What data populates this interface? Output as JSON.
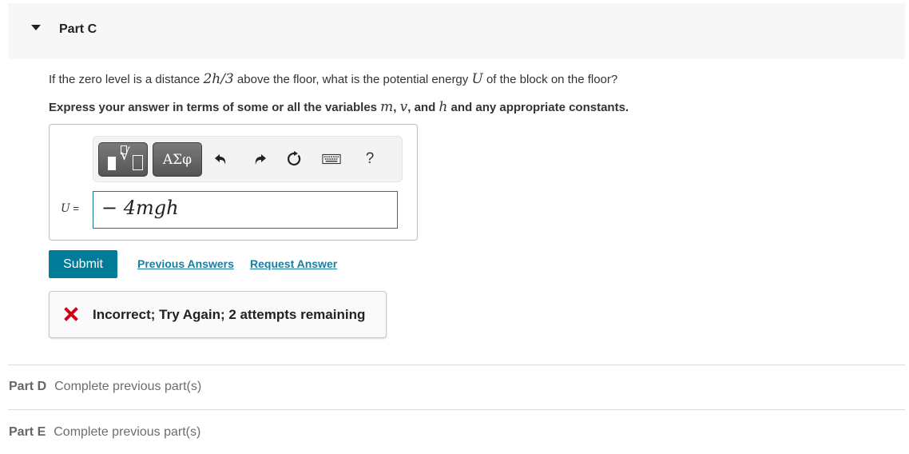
{
  "part_c": {
    "title": "Part C",
    "expanded": true,
    "question": {
      "prefix": "If the zero level is a distance ",
      "expr": "2h/3",
      "middle": " above the floor, what is the potential energy ",
      "var": "U",
      "suffix": " of the block on the floor?"
    },
    "instruction": {
      "prefix": "Express your answer in terms of some or all the variables ",
      "v1": "m",
      "sep1": ", ",
      "v2": "v",
      "sep2": ", and ",
      "v3": "h",
      "suffix": " and any appropriate constants."
    },
    "toolbar": {
      "templates_icon": "templates-icon",
      "symbols_label": "ΑΣφ",
      "undo_icon": "undo-icon",
      "redo_icon": "redo-icon",
      "reset_icon": "reset-icon",
      "keyboard_icon": "keyboard-icon",
      "help_label": "?"
    },
    "answer": {
      "variable": "U",
      "equals": " =",
      "value": "− 4mgh"
    },
    "actions": {
      "submit_label": "Submit",
      "previous_answers_label": "Previous Answers",
      "request_answer_label": "Request Answer"
    },
    "feedback": {
      "status": "incorrect",
      "icon": "x-icon",
      "message": "Incorrect; Try Again; 2 attempts remaining",
      "attempts_remaining": 2
    }
  },
  "locked_parts": [
    {
      "label": "Part D",
      "status": "Complete previous part(s)"
    },
    {
      "label": "Part E",
      "status": "Complete previous part(s)"
    }
  ],
  "colors": {
    "accent": "#007c99",
    "link": "#1a7ea1",
    "error": "#d0021b",
    "input_border": "#1a7a8e"
  }
}
